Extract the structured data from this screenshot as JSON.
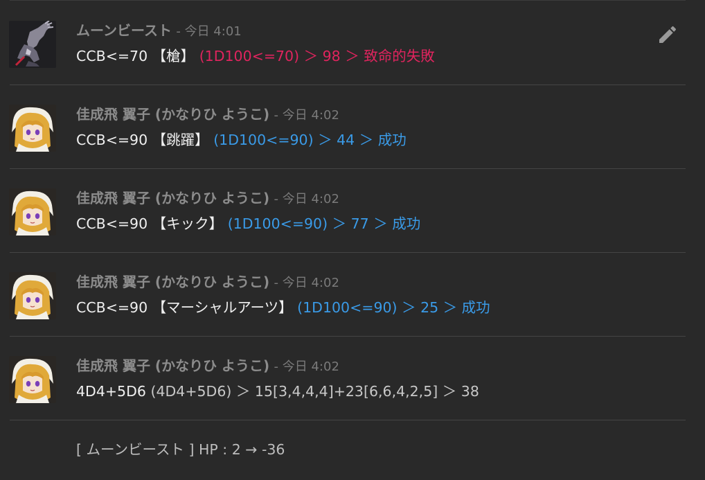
{
  "messages": [
    {
      "sender": "ムーンビースト",
      "time": "- 今日 4:01",
      "command": "CCB<=70 【槍】",
      "result": "(1D100<=70) ＞ 98 ＞ 致命的失敗",
      "avatar_icon": "moonbeast-avatar",
      "edit_icon": "pencil-icon"
    },
    {
      "sender": "佳成飛 翼子 (かなりひ ようこ)",
      "time": "- 今日 4:02",
      "command": "CCB<=90 【跳躍】",
      "result": "(1D100<=90) ＞ 44 ＞ 成功",
      "avatar_icon": "yoko-avatar"
    },
    {
      "sender": "佳成飛 翼子 (かなりひ ようこ)",
      "time": "- 今日 4:02",
      "command": "CCB<=90 【キック】",
      "result": "(1D100<=90) ＞ 77 ＞ 成功",
      "avatar_icon": "yoko-avatar"
    },
    {
      "sender": "佳成飛 翼子 (かなりひ ようこ)",
      "time": "- 今日 4:02",
      "command": "CCB<=90 【マーシャルアーツ】",
      "result": "(1D100<=90) ＞ 25 ＞ 成功",
      "avatar_icon": "yoko-avatar"
    },
    {
      "sender": "佳成飛 翼子 (かなりひ ようこ)",
      "time": "- 今日 4:02",
      "command": "4D4+5D6",
      "result": "(4D4+5D6) ＞ 15[3,4,4,4]+23[6,6,4,2,5] ＞ 38",
      "avatar_icon": "yoko-avatar"
    }
  ],
  "system_message": "[ ムーンビースト ] HP : 2 → -36",
  "colors": {
    "background": "#292929",
    "fail": "#e0245e",
    "success": "#3a9be8",
    "name": "#8c8c8c"
  }
}
